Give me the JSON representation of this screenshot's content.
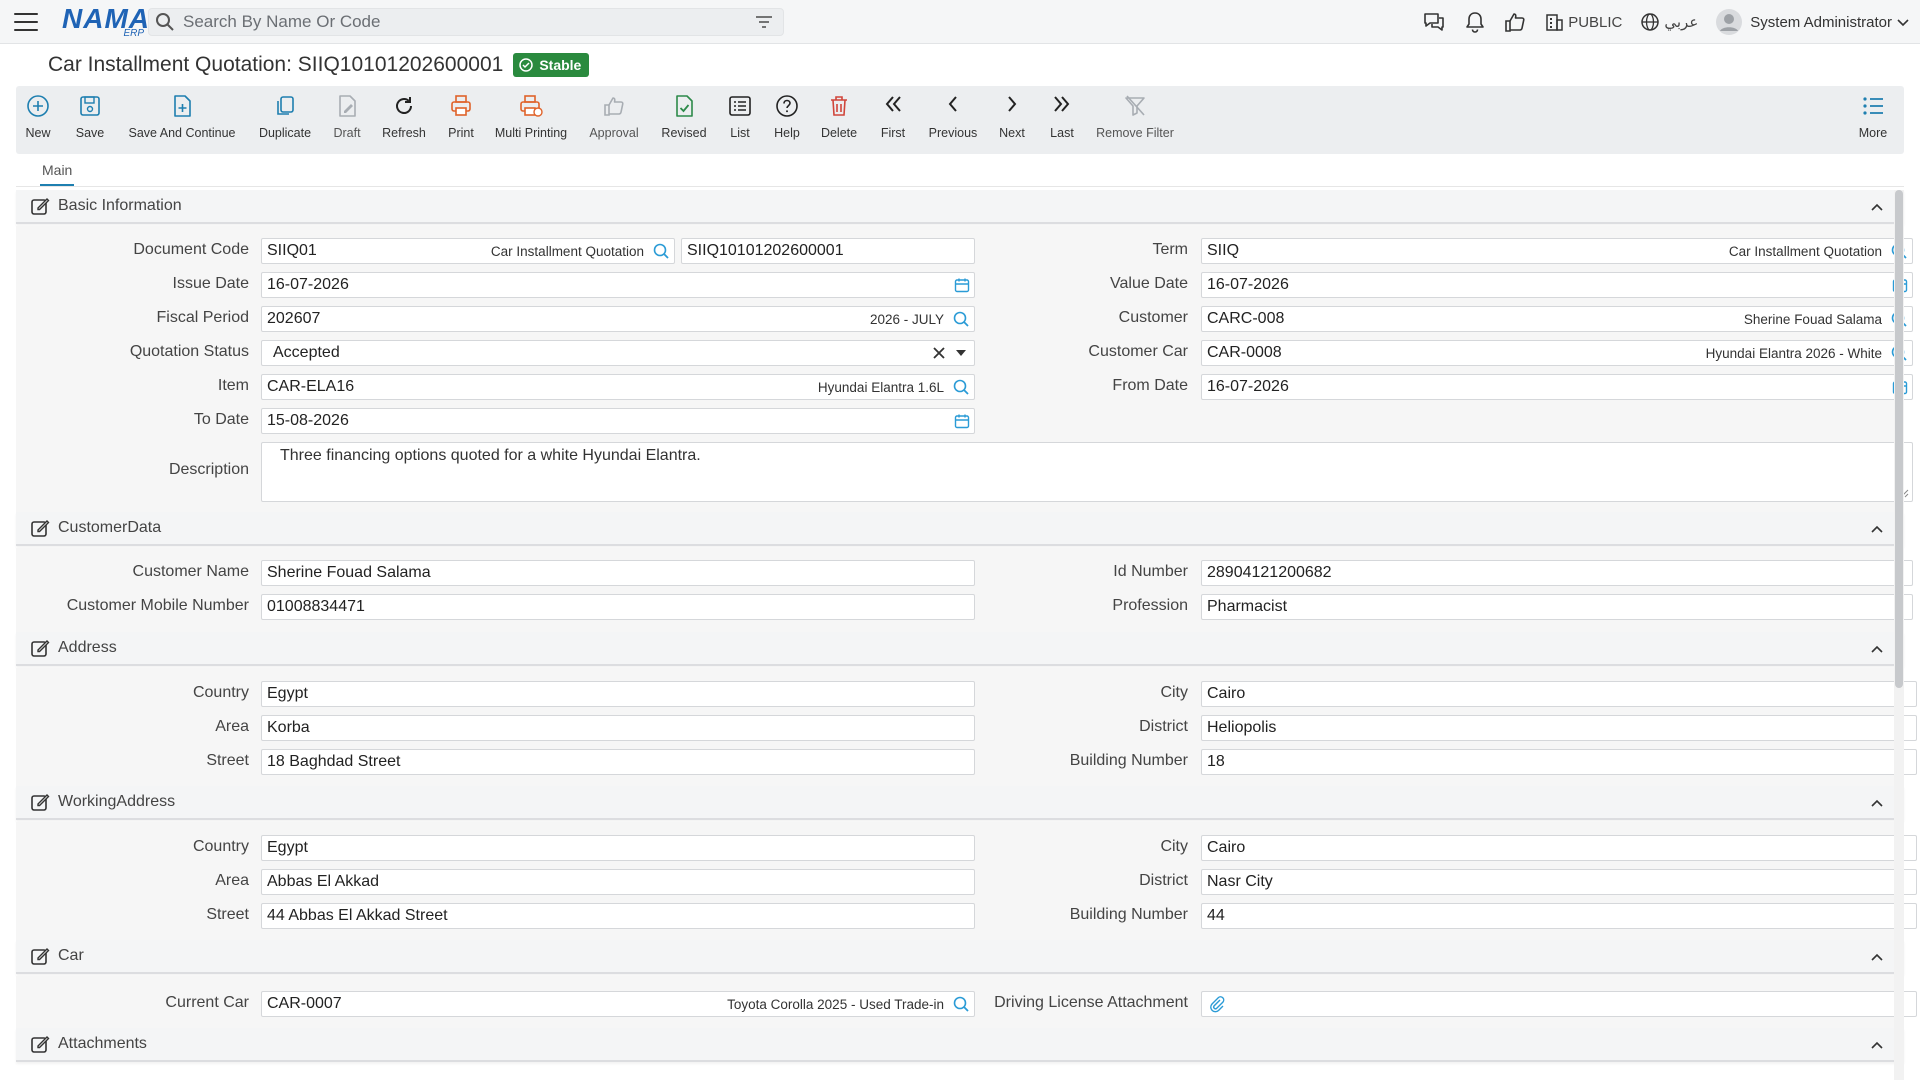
{
  "app": {
    "logo_text": "NAMA",
    "logo_sub": "ERP",
    "search_placeholder": "Search By Name Or Code",
    "public_label": "PUBLIC",
    "language_label": "عربي",
    "user_name": "System Administrator"
  },
  "page": {
    "title": "Car Installment Quotation: SIIQ10101202600001",
    "status": "Stable"
  },
  "toolbar": {
    "new": "New",
    "save": "Save",
    "save_continue": "Save And Continue",
    "duplicate": "Duplicate",
    "draft": "Draft",
    "refresh": "Refresh",
    "print": "Print",
    "multi_printing": "Multi Printing",
    "approval": "Approval",
    "revised": "Revised",
    "list": "List",
    "help": "Help",
    "delete": "Delete",
    "first": "First",
    "previous": "Previous",
    "next": "Next",
    "last": "Last",
    "remove_filter": "Remove Filter",
    "more": "More"
  },
  "tabs": {
    "main": "Main"
  },
  "basic": {
    "header": "Basic Information",
    "document_code_label": "Document Code",
    "document_code": "SIIQ01",
    "document_code_desc": "Car Installment Quotation",
    "document_number": "SIIQ10101202600001",
    "issue_date_label": "Issue Date",
    "issue_date": "16-07-2026",
    "fiscal_period_label": "Fiscal Period",
    "fiscal_period": "202607",
    "fiscal_period_desc": "2026 - JULY",
    "quotation_status_label": "Quotation Status",
    "quotation_status": "Accepted",
    "item_label": "Item",
    "item": "CAR-ELA16",
    "item_desc": "Hyundai Elantra 1.6L",
    "to_date_label": "To Date",
    "to_date": "15-08-2026",
    "term_label": "Term",
    "term": "SIIQ",
    "term_desc": "Car Installment Quotation",
    "value_date_label": "Value Date",
    "value_date": "16-07-2026",
    "customer_label": "Customer",
    "customer": "CARC-008",
    "customer_desc": "Sherine Fouad Salama",
    "customer_car_label": "Customer Car",
    "customer_car": "CAR-0008",
    "customer_car_desc": "Hyundai Elantra 2026 - White",
    "from_date_label": "From Date",
    "from_date": "16-07-2026",
    "description_label": "Description",
    "description": "Three financing options quoted for a white Hyundai Elantra."
  },
  "customer_data": {
    "header": "CustomerData",
    "name_label": "Customer Name",
    "name": "Sherine Fouad Salama",
    "mobile_label": "Customer Mobile Number",
    "mobile": "01008834471",
    "id_label": "Id Number",
    "id": "28904121200682",
    "profession_label": "Profession",
    "profession": "Pharmacist"
  },
  "address": {
    "header": "Address",
    "country_label": "Country",
    "country": "Egypt",
    "area_label": "Area",
    "area": "Korba",
    "street_label": "Street",
    "street": "18 Baghdad Street",
    "city_label": "City",
    "city": "Cairo",
    "district_label": "District",
    "district": "Heliopolis",
    "building_label": "Building Number",
    "building": "18"
  },
  "working_address": {
    "header": "WorkingAddress",
    "country_label": "Country",
    "country": "Egypt",
    "area_label": "Area",
    "area": "Abbas El Akkad",
    "street_label": "Street",
    "street": "44 Abbas El Akkad Street",
    "city_label": "City",
    "city": "Cairo",
    "district_label": "District",
    "district": "Nasr City",
    "building_label": "Building Number",
    "building": "44"
  },
  "car": {
    "header": "Car",
    "current_car_label": "Current Car",
    "current_car": "CAR-0007",
    "current_car_desc": "Toyota Corolla 2025 - Used Trade-in",
    "license_label": "Driving License Attachment"
  },
  "attachments": {
    "header": "Attachments"
  },
  "colors": {
    "brand": "#1f63b5",
    "status_green": "#2a8a3e",
    "accent_blue": "#1e7fb0",
    "print_orange": "#e0632a",
    "delete_red": "#d0453a",
    "revised_green": "#2d8a4a"
  }
}
